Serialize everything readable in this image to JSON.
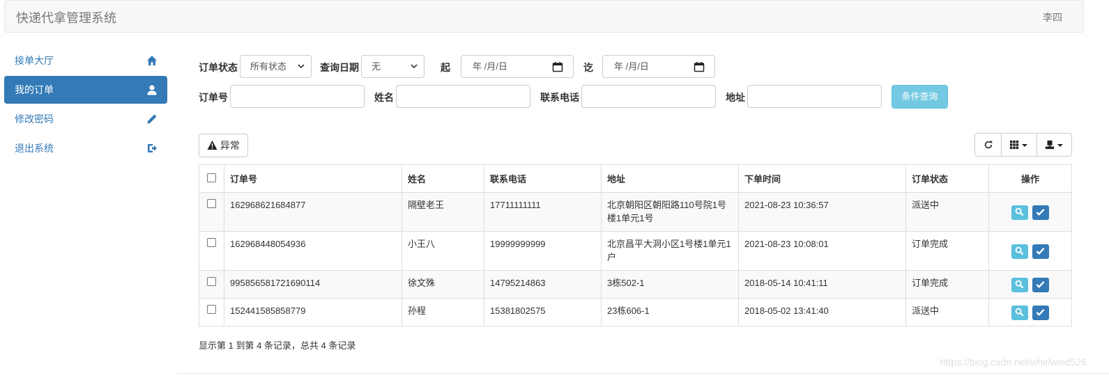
{
  "header": {
    "title": "快递代拿管理系统",
    "user": "李四"
  },
  "sidebar": {
    "items": [
      {
        "label": "接单大厅",
        "icon": "home-icon"
      },
      {
        "label": "我的订单",
        "icon": "user-icon",
        "active": true
      },
      {
        "label": "修改密码",
        "icon": "pencil-icon"
      },
      {
        "label": "退出系统",
        "icon": "logout-icon"
      }
    ]
  },
  "filters": {
    "status_label": "订单状态",
    "status_value": "所有状态",
    "date_label": "查询日期",
    "date_value": "无",
    "from_label": "起",
    "from_placeholder": "年 /月/日",
    "to_label": "讫",
    "to_placeholder": "年 /月/日",
    "order_no_label": "订单号",
    "name_label": "姓名",
    "phone_label": "联系电话",
    "address_label": "地址",
    "search_button": "条件查询"
  },
  "toolbar": {
    "exception_button": "异常"
  },
  "table": {
    "columns": [
      "订单号",
      "姓名",
      "联系电话",
      "地址",
      "下单时间",
      "订单状态",
      "操作"
    ],
    "rows": [
      {
        "order_no": "162968621684877",
        "name": "隔壁老王",
        "phone": "17711111111",
        "address": "北京朝阳区朝阳路110号院1号楼1单元1号",
        "time": "2021-08-23 10:36:57",
        "status": "派送中",
        "status_type": "blue"
      },
      {
        "order_no": "162968448054936",
        "name": "小王八",
        "phone": "19999999999",
        "address": "北京昌平大洞小区1号楼1单元1户",
        "time": "2021-08-23 10:08:01",
        "status": "订单完成",
        "status_type": "green"
      },
      {
        "order_no": "995856581721690114",
        "name": "徐文殊",
        "phone": "14795214863",
        "address": "3栋502-1",
        "time": "2018-05-14 10:41:11",
        "status": "订单完成",
        "status_type": "green"
      },
      {
        "order_no": "152441585858779",
        "name": "孙程",
        "phone": "15381802575",
        "address": "23栋606-1",
        "time": "2018-05-02 13:41:40",
        "status": "派送中",
        "status_type": "blue"
      }
    ]
  },
  "pagination": {
    "info": "显示第 1 到第 4 条记录，总共 4 条记录"
  },
  "watermark": "https://blog.csdn.net/whirlwind526",
  "colors": {
    "primary": "#337ab7",
    "info": "#5bc0de",
    "success": "#4f8f2f"
  }
}
